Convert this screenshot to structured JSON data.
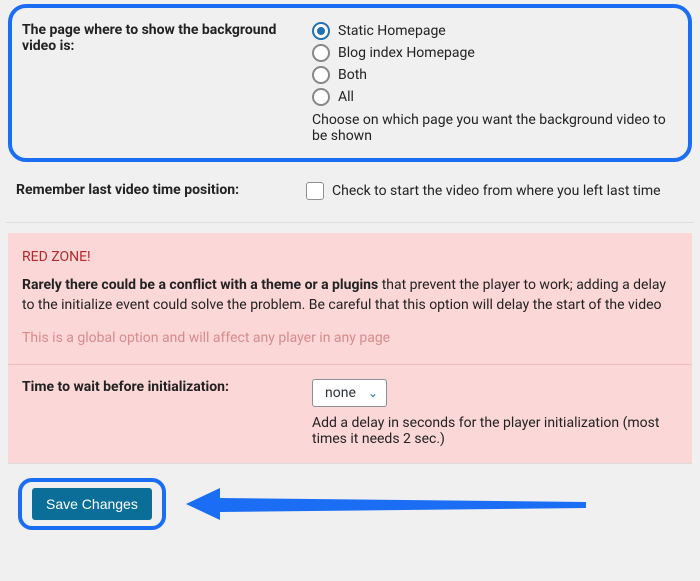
{
  "page_location": {
    "label": "The page where to show the background video is:",
    "options": [
      {
        "label": "Static Homepage",
        "checked": true
      },
      {
        "label": "Blog index Homepage",
        "checked": false
      },
      {
        "label": "Both",
        "checked": false
      },
      {
        "label": "All",
        "checked": false
      }
    ],
    "desc": "Choose on which page you want the background video to be shown"
  },
  "remember": {
    "label": "Remember last video time position:",
    "check_label": "Check to start the video from where you left last time"
  },
  "redzone": {
    "title": "RED ZONE!",
    "body_bold": "Rarely there could be a conflict with a theme or a plugins",
    "body_rest": " that prevent the player to work; adding a delay to the initialize event could solve the problem. Be careful that this option will delay the start of the video",
    "note": "This is a global option and will affect any player in any page",
    "time_label": "Time to wait before initialization:",
    "select_value": "none",
    "subdesc": "Add a delay in seconds for the player initialization (most times it needs 2 sec.)"
  },
  "save_label": "Save Changes"
}
